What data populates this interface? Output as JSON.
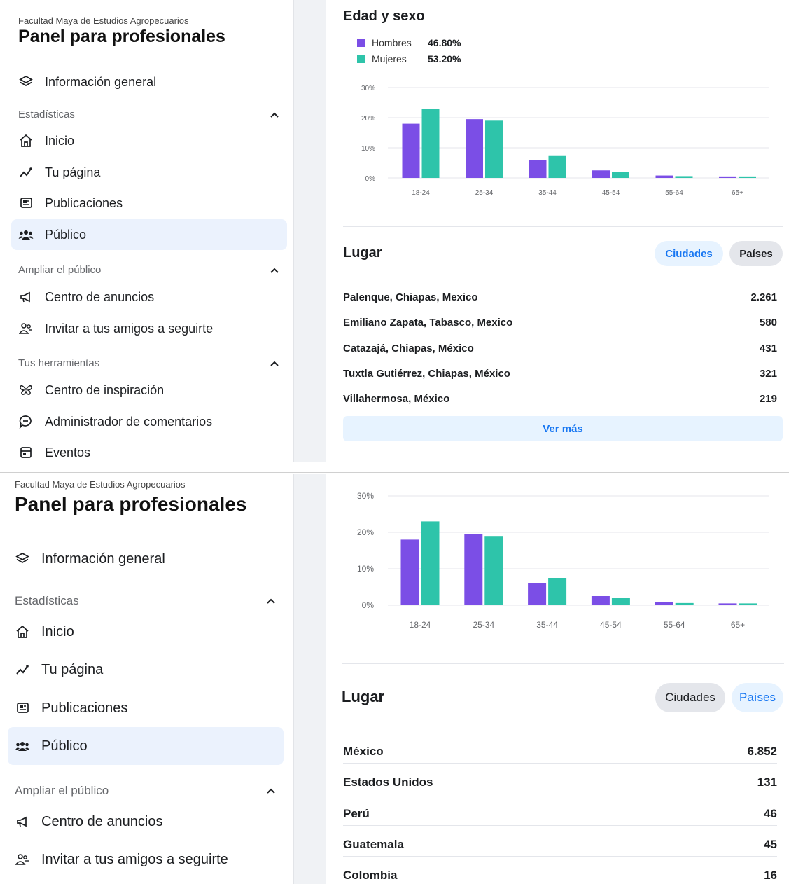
{
  "sidebar": {
    "org_name": "Facultad Maya de Estudios Agropecuarios",
    "panel_title": "Panel para profesionales",
    "overview_label": "Información general",
    "sections": {
      "estadisticas": "Estadísticas",
      "ampliar": "Ampliar el público",
      "herramientas": "Tus herramientas"
    },
    "items": {
      "inicio": "Inicio",
      "tu_pagina": "Tu página",
      "publicaciones": "Publicaciones",
      "publico": "Público",
      "centro_anuncios": "Centro de anuncios",
      "invitar": "Invitar a tus amigos a seguirte",
      "centro_inspiracion": "Centro de inspiración",
      "admin_comentarios": "Administrador de comentarios",
      "eventos": "Eventos"
    },
    "active_item": "Público"
  },
  "age_gender": {
    "title": "Edad y sexo",
    "legend": [
      {
        "name": "Hombres",
        "value": "46.80%"
      },
      {
        "name": "Mujeres",
        "value": "53.20%"
      }
    ]
  },
  "chart_data": {
    "type": "bar",
    "categories": [
      "18-24",
      "25-34",
      "35-44",
      "45-54",
      "55-64",
      "65+"
    ],
    "series": [
      {
        "name": "Hombres",
        "values": [
          18,
          19.5,
          6,
          2.5,
          0.8,
          0.5
        ],
        "color": "#7b4ee6"
      },
      {
        "name": "Mujeres",
        "values": [
          23,
          19,
          7.5,
          2,
          0.6,
          0.5
        ],
        "color": "#2ec4aa"
      }
    ],
    "yticks": [
      "0%",
      "10%",
      "20%",
      "30%"
    ],
    "ylim": [
      0,
      30
    ],
    "grid": true
  },
  "lugar": {
    "title": "Lugar",
    "toggle_cities": "Ciudades",
    "toggle_countries": "Países",
    "cities": [
      {
        "name": "Palenque, Chiapas, Mexico",
        "value": "2.261"
      },
      {
        "name": "Emiliano Zapata, Tabasco, Mexico",
        "value": "580"
      },
      {
        "name": "Catazajá, Chiapas, México",
        "value": "431"
      },
      {
        "name": "Tuxtla Gutiérrez, Chiapas, México",
        "value": "321"
      },
      {
        "name": "Villahermosa, México",
        "value": "219"
      }
    ],
    "ver_mas": "Ver más",
    "countries": [
      {
        "name": "México",
        "value": "6.852"
      },
      {
        "name": "Estados Unidos",
        "value": "131"
      },
      {
        "name": "Perú",
        "value": "46"
      },
      {
        "name": "Guatemala",
        "value": "45"
      },
      {
        "name": "Colombia",
        "value": "16"
      }
    ]
  },
  "colors": {
    "accent": "#1877f2",
    "active_bg": "#ebf2fd",
    "hombres": "#7b4ee6",
    "mujeres": "#2ec4aa"
  }
}
